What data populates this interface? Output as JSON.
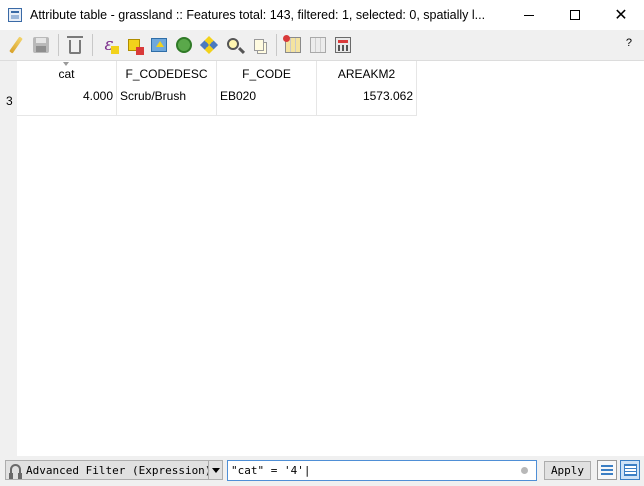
{
  "window": {
    "title": "Attribute table - grassland :: Features total: 143, filtered: 1, selected: 0, spatially l...",
    "minimize_glyph": "",
    "close_glyph": "✕"
  },
  "toolbar": {
    "help_label": "?",
    "buttons": [
      {
        "icon": "pencil-icon",
        "name": "toggle-editing-button"
      },
      {
        "icon": "save-icon",
        "name": "save-edits-button"
      },
      {
        "icon": "trash-icon",
        "name": "delete-features-button"
      },
      {
        "icon": "expression-select-icon",
        "name": "select-by-expression-button"
      },
      {
        "icon": "deselect-icon",
        "name": "deselect-all-button"
      },
      {
        "icon": "move-to-top-icon",
        "name": "move-selection-top-button"
      },
      {
        "icon": "invert-selection-icon",
        "name": "invert-selection-button"
      },
      {
        "icon": "pan-to-selection-icon",
        "name": "pan-map-button"
      },
      {
        "icon": "zoom-to-selection-icon",
        "name": "zoom-map-button"
      },
      {
        "icon": "copy-icon",
        "name": "copy-rows-button"
      },
      {
        "icon": "new-field-icon",
        "name": "new-field-button"
      },
      {
        "icon": "delete-field-icon",
        "name": "delete-field-button"
      },
      {
        "icon": "field-calculator-icon",
        "name": "field-calculator-button"
      }
    ]
  },
  "table": {
    "columns": [
      "cat",
      "F_CODEDESC",
      "F_CODE",
      "AREAKM2"
    ],
    "rows": [
      {
        "row_number": "3",
        "cells": [
          "4.000",
          "Scrub/Brush",
          "EB020",
          "1573.062"
        ]
      }
    ]
  },
  "filter_bar": {
    "filter_mode": "Advanced Filter (Expression)",
    "expression": "\"cat\" = '4'|",
    "apply_label": "Apply"
  }
}
